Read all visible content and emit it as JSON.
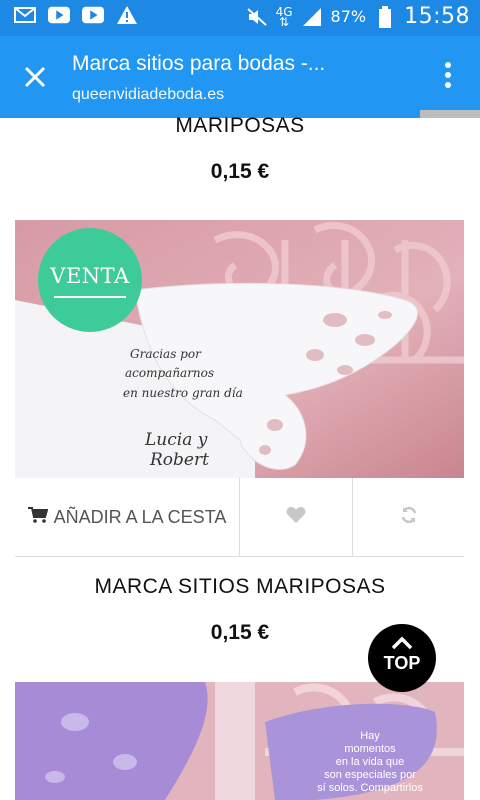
{
  "status_bar": {
    "network": "4G",
    "battery": "87%",
    "time": "15:58"
  },
  "tab": {
    "title": "Marca sitios para bodas -...",
    "url": "queenvidiadeboda.es"
  },
  "products": [
    {
      "title": "MARIPOSAS",
      "price": "0,15 €"
    },
    {
      "title": "MARCA SITIOS MARIPOSAS",
      "price": "0,15 €",
      "badge": "VENTA",
      "image_text": [
        "Gracias por",
        "acompañarnos",
        "en nuestro gran día",
        "Lucia y",
        "Robert"
      ],
      "add_to_cart": "AÑADIR A LA CESTA",
      "image2_text": [
        "Hay",
        "momentos",
        "en la vida que",
        "son especiales por",
        "sí solos. Compartirlos"
      ]
    }
  ],
  "top_button": "TOP",
  "colors": {
    "status_bar": "#1e88e5",
    "tab_bar": "#2196f3",
    "badge": "#3ecb9a"
  }
}
